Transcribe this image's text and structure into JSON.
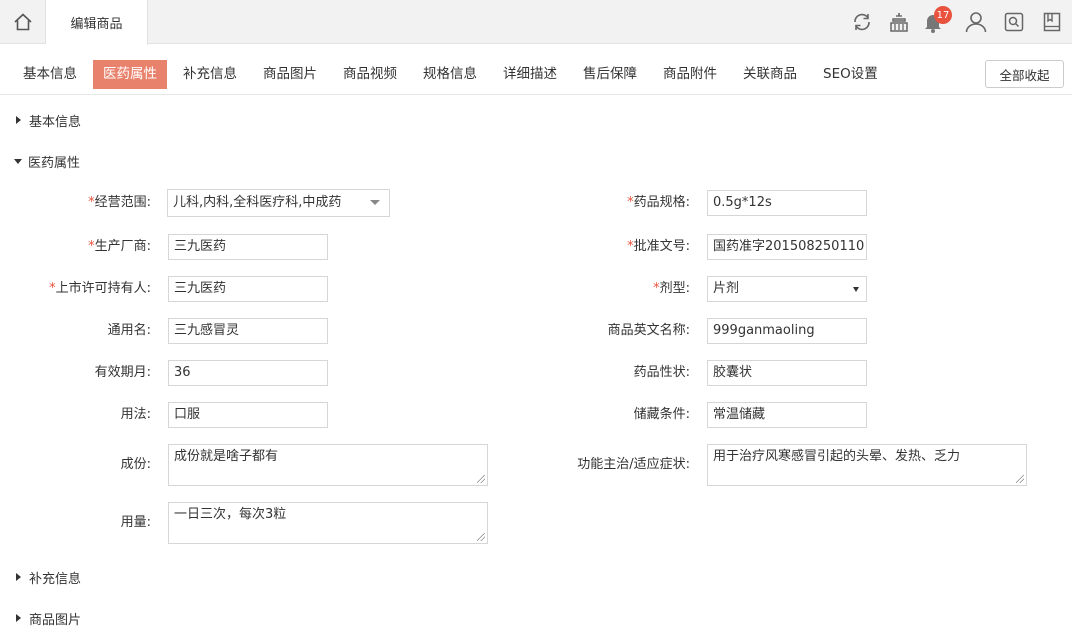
{
  "topbar": {
    "tab_title": "编辑商品",
    "notification_count": "17",
    "icons": [
      "home-icon",
      "refresh-icon",
      "store-icon",
      "bell-icon",
      "user-icon",
      "search-box-icon",
      "bookmark-icon"
    ]
  },
  "nav": {
    "items": [
      "基本信息",
      "医药属性",
      "补充信息",
      "商品图片",
      "商品视频",
      "规格信息",
      "详细描述",
      "售后保障",
      "商品附件",
      "关联商品",
      "SEO设置"
    ],
    "active_index": 1,
    "collapse_label": "全部收起"
  },
  "sections": {
    "basic": "基本信息",
    "medicine": "医药属性",
    "supplement": "补充信息",
    "images": "商品图片"
  },
  "form": {
    "business_scope": {
      "label": "经营范围:",
      "value": "儿科,内科,全科医疗科,中成药"
    },
    "drug_spec": {
      "label": "药品规格:",
      "value": "0.5g*12s"
    },
    "manufacturer": {
      "label": "生产厂商:",
      "value": "三九医药"
    },
    "approval_no": {
      "label": "批准文号:",
      "value": "国药准字201508250110"
    },
    "license_holder": {
      "label": "上市许可持有人:",
      "value": "三九医药"
    },
    "dosage_form": {
      "label": "剂型:",
      "value": "片剂"
    },
    "generic_name": {
      "label": "通用名:",
      "value": "三九感冒灵"
    },
    "english_name": {
      "label": "商品英文名称:",
      "value": "999ganmaoling"
    },
    "validity": {
      "label": "有效期月:",
      "value": "36"
    },
    "properties": {
      "label": "药品性状:",
      "value": "胶囊状"
    },
    "usage": {
      "label": "用法:",
      "value": "口服"
    },
    "storage": {
      "label": "储藏条件:",
      "value": "常温储藏"
    },
    "ingredients": {
      "label": "成份:",
      "value": "成份就是啥子都有"
    },
    "indications": {
      "label": "功能主治/适应症状:",
      "value": "用于治疗风寒感冒引起的头晕、发热、乏力"
    },
    "dosage": {
      "label": "用量:",
      "value": "一日三次，每次3粒"
    }
  },
  "colors": {
    "accent": "#e9826d",
    "required": "#e9523d",
    "badge": "#e9523d"
  }
}
